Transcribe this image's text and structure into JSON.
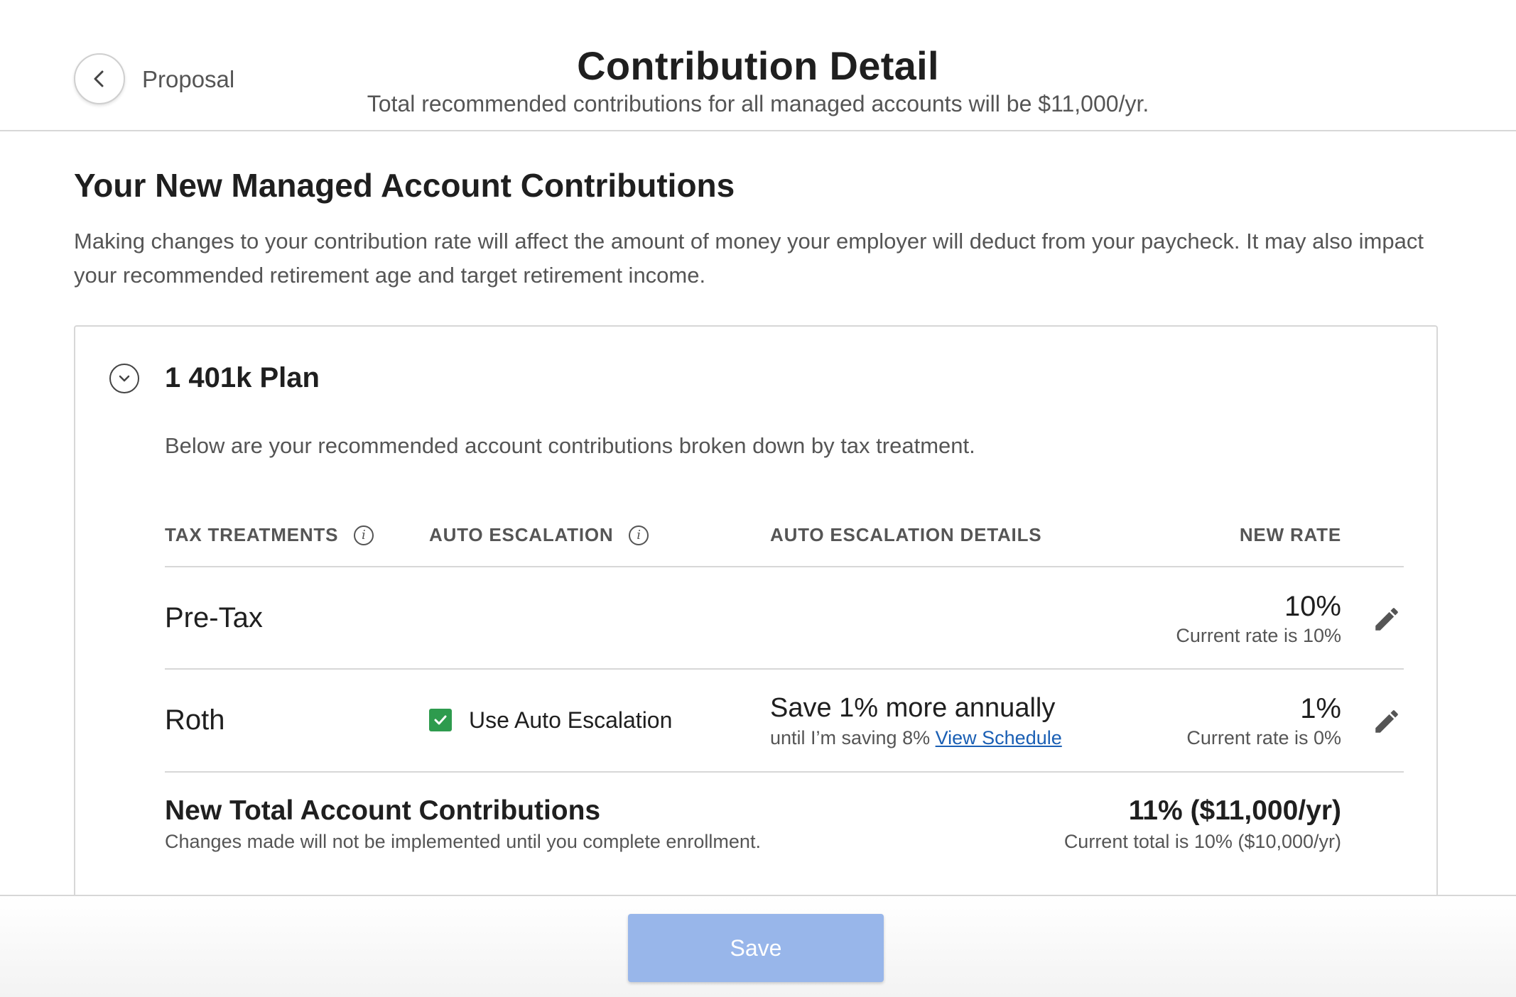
{
  "header": {
    "back_label": "Proposal",
    "title": "Contribution Detail",
    "subtitle": "Total recommended contributions for all managed accounts will be $11,000/yr."
  },
  "section": {
    "title": "Your New Managed Account Contributions",
    "description": "Making changes to your contribution rate will affect the amount of money your employer will deduct from your paycheck. It may also impact your recommended retirement age and target retirement income."
  },
  "plan": {
    "title": "1 401k Plan",
    "description": "Below are your recommended account contributions broken down by tax treatment.",
    "columns": {
      "tax_treatments": "TAX TREATMENTS",
      "auto_escalation": "AUTO ESCALATION",
      "auto_escalation_details": "AUTO ESCALATION DETAILS",
      "new_rate": "NEW RATE"
    },
    "rows": [
      {
        "label": "Pre-Tax",
        "new_rate": "10%",
        "current_rate": "Current rate is 10%"
      },
      {
        "label": "Roth",
        "auto_escalation_label": "Use Auto Escalation",
        "auto_escalation_checked": true,
        "details_main": "Save 1% more annually",
        "details_sub": "until I’m saving 8%",
        "details_link": "View Schedule",
        "new_rate": "1%",
        "current_rate": "Current rate is 0%"
      }
    ],
    "total": {
      "title": "New Total Account Contributions",
      "note": "Changes made will not be implemented until you complete enrollment.",
      "value": "11% ($11,000/yr)",
      "current": "Current total is 10% ($10,000/yr)"
    }
  },
  "footer": {
    "save_label": "Save"
  },
  "colors": {
    "checkbox_green": "#2e9b4e",
    "link_blue": "#1a5fb4",
    "save_button_disabled": "#98b6ea",
    "divider": "#d7d7d7"
  },
  "icons": {
    "back": "chevron-left-icon",
    "collapse": "chevron-down-icon",
    "info": "info-icon",
    "edit": "pencil-icon",
    "checkbox": "check-icon"
  }
}
